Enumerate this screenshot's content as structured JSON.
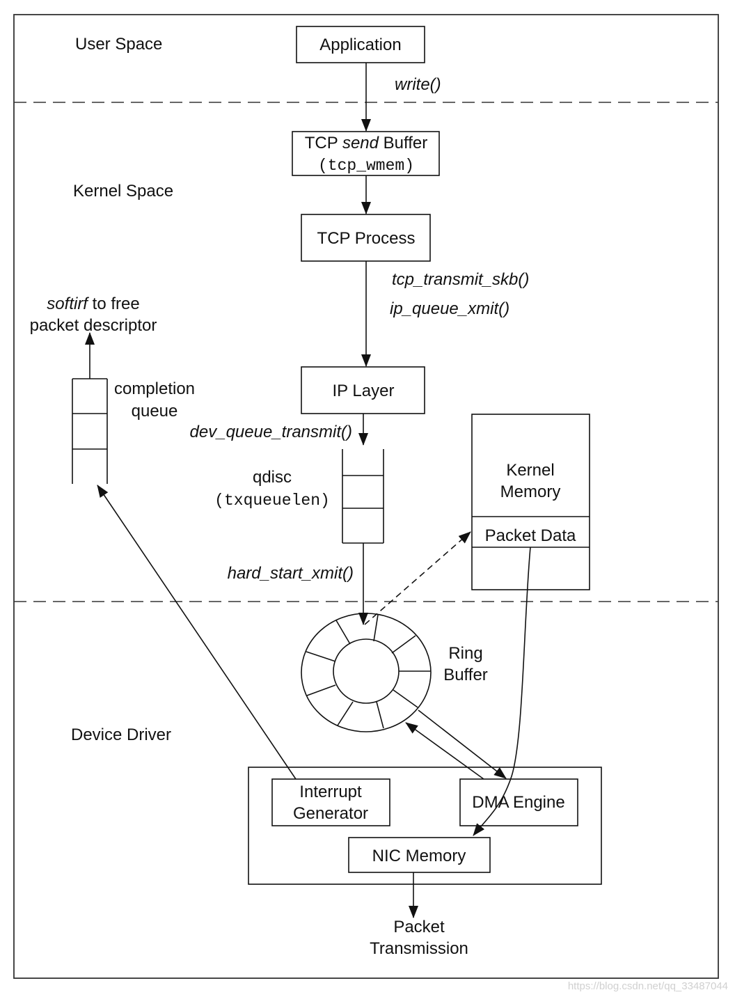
{
  "zones": {
    "user_space": "User Space",
    "kernel_space": "Kernel Space",
    "device_driver": "Device Driver"
  },
  "nodes": {
    "application": "Application",
    "tcp_send_buffer": {
      "prefix": "TCP ",
      "italic": "send",
      "suffix": " Buffer",
      "param": "(tcp_wmem)"
    },
    "tcp_process": "TCP Process",
    "ip_layer": "IP Layer",
    "qdisc": {
      "label": "qdisc",
      "param": "(txqueuelen)"
    },
    "kernel_memory": {
      "line1": "Kernel",
      "line2": "Memory",
      "packet_data": "Packet Data"
    },
    "ring_buffer": {
      "line1": "Ring",
      "line2": "Buffer"
    },
    "completion_queue": {
      "line1": "completion",
      "line2": "queue"
    },
    "softirq": {
      "italic": "softirf",
      "suffix": " to free",
      "line2": "packet descriptor"
    },
    "interrupt_generator": {
      "line1": "Interrupt",
      "line2": "Generator"
    },
    "dma_engine": "DMA Engine",
    "nic_memory": "NIC Memory",
    "packet_transmission": {
      "line1": "Packet",
      "line2": "Transmission"
    }
  },
  "calls": {
    "write": "write()",
    "tcp_transmit_skb": "tcp_transmit_skb()",
    "ip_queue_xmit": "ip_queue_xmit()",
    "dev_queue_transmit": "dev_queue_transmit()",
    "hard_start_xmit": "hard_start_xmit()"
  },
  "watermark": "https://blog.csdn.net/qq_33487044"
}
